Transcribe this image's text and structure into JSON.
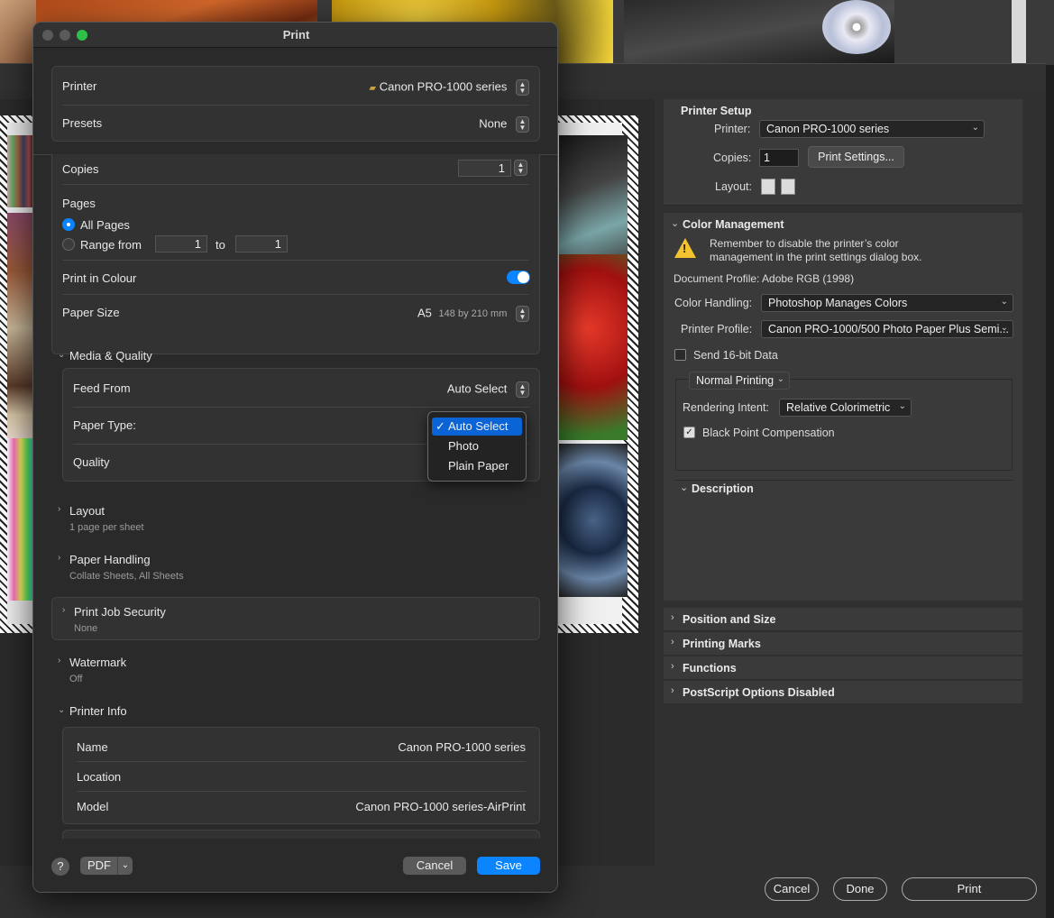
{
  "dialog": {
    "title": "Print",
    "printer_label": "Printer",
    "printer_value": "Canon PRO-1000 series",
    "presets_label": "Presets",
    "presets_value": "None",
    "copies_label": "Copies",
    "copies_value": "1",
    "pages_label": "Pages",
    "all_pages_label": "All Pages",
    "range_from_label": "Range from",
    "range_from_value": "1",
    "range_to_label": "to",
    "range_to_value": "1",
    "print_colour_label": "Print in Colour",
    "paper_size_label": "Paper Size",
    "paper_size_value": "A5",
    "paper_size_dims": "148 by 210 mm",
    "media_quality_label": "Media & Quality",
    "feed_from_label": "Feed From",
    "feed_from_value": "Auto Select",
    "paper_type_label": "Paper Type:",
    "quality_label": "Quality",
    "paper_type_options": [
      "Auto Select",
      "Photo",
      "Plain Paper"
    ],
    "paper_type_selected": "Auto Select",
    "layout_label": "Layout",
    "layout_sub": "1 page per sheet",
    "paper_handling_label": "Paper Handling",
    "paper_handling_sub": "Collate Sheets, All Sheets",
    "print_job_security_label": "Print Job Security",
    "print_job_security_sub": "None",
    "watermark_label": "Watermark",
    "watermark_sub": "Off",
    "printer_info_label": "Printer Info",
    "info_name_label": "Name",
    "info_name_value": "Canon PRO-1000 series",
    "info_location_label": "Location",
    "info_model_label": "Model",
    "info_model_value": "Canon PRO-1000 series-AirPrint",
    "help_label": "?",
    "pdf_label": "PDF",
    "cancel_label": "Cancel",
    "save_label": "Save"
  },
  "photoshop": {
    "printer_setup_title": "Printer Setup",
    "printer_label": "Printer:",
    "printer_value": "Canon PRO-1000 series",
    "copies_label": "Copies:",
    "copies_value": "1",
    "print_settings_label": "Print Settings...",
    "layout_label": "Layout:",
    "color_management_title": "Color Management",
    "warning_text": "Remember to disable the printer’s color management in the print settings dialog box.",
    "document_profile": "Document Profile: Adobe RGB (1998)",
    "color_handling_label": "Color Handling:",
    "color_handling_value": "Photoshop Manages Colors",
    "printer_profile_label": "Printer Profile:",
    "printer_profile_value": "Canon PRO-1000/500 Photo Paper Plus Semi...",
    "send16_label": "Send 16-bit Data",
    "normal_printing_value": "Normal Printing",
    "rendering_intent_label": "Rendering Intent:",
    "rendering_intent_value": "Relative Colorimetric",
    "black_point_label": "Black Point Compensation",
    "description_title": "Description",
    "sections": [
      "Position and Size",
      "Printing Marks",
      "Functions",
      "PostScript Options Disabled"
    ],
    "cancel_label": "Cancel",
    "done_label": "Done",
    "print_label": "Print"
  },
  "colors": {
    "accent": "#0a84ff",
    "warning": "#f4c430"
  }
}
